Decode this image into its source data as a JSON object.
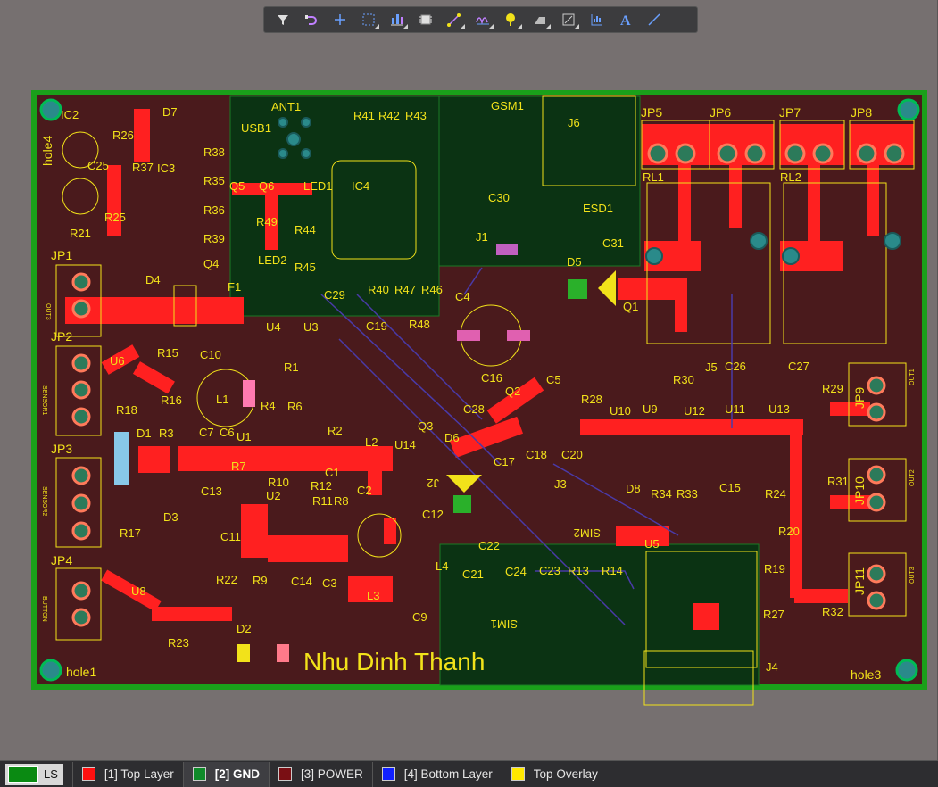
{
  "toolbar": {
    "tools": [
      {
        "name": "filter-icon"
      },
      {
        "name": "route-icon"
      },
      {
        "name": "add-icon"
      },
      {
        "name": "select-rect-icon"
      },
      {
        "name": "align-icon"
      },
      {
        "name": "component-icon"
      },
      {
        "name": "interactive-route-icon"
      },
      {
        "name": "diff-pair-icon"
      },
      {
        "name": "place-pad-icon"
      },
      {
        "name": "polygon-icon"
      },
      {
        "name": "dimension-icon"
      },
      {
        "name": "chart-icon"
      },
      {
        "name": "text-icon"
      },
      {
        "name": "line-icon"
      }
    ]
  },
  "board": {
    "designer_text": "Nhu Dinh Thanh",
    "hole_labels": [
      "hole1",
      "hole3",
      "hole4"
    ],
    "connector_labels": [
      "JP1",
      "JP2",
      "JP3",
      "JP4",
      "JP5",
      "JP6",
      "JP7",
      "JP8",
      "JP9",
      "JP10",
      "JP11"
    ],
    "component_labels": [
      "IC2",
      "IC3",
      "IC4",
      "D7",
      "R26",
      "C25",
      "R37",
      "R38",
      "R35",
      "R36",
      "R39",
      "Q4",
      "Q5",
      "Q6",
      "LED1",
      "LED2",
      "R49",
      "R44",
      "R45",
      "ANT1",
      "USB1",
      "R41",
      "R42",
      "R43",
      "GSM1",
      "J6",
      "C30",
      "J1",
      "ESD1",
      "C31",
      "RL1",
      "RL2",
      "D4",
      "D5",
      "F1",
      "C29",
      "R40",
      "R47",
      "R46",
      "C19",
      "R48",
      "C4",
      "Q1",
      "U4",
      "U3",
      "R15",
      "C10",
      "U6",
      "R1",
      "L1",
      "R16",
      "R18",
      "D1",
      "R3",
      "C7",
      "C6",
      "U1",
      "R2",
      "R4",
      "R6",
      "C1",
      "L2",
      "U14",
      "D6",
      "Q3",
      "C28",
      "C16",
      "Q2",
      "C5",
      "R28",
      "U10",
      "U9",
      "U12",
      "U11",
      "U13",
      "R30",
      "J5",
      "C26",
      "C27",
      "R29",
      "R31",
      "R24",
      "R20",
      "R19",
      "R27",
      "R32",
      "J4",
      "U2",
      "R12",
      "C13",
      "R11",
      "R8",
      "C2",
      "R7",
      "D3",
      "R17",
      "C11",
      "U8",
      "R22",
      "R9",
      "C14",
      "C3",
      "L3",
      "C12",
      "C17",
      "C18",
      "J3",
      "C20",
      "D8",
      "R34",
      "R33",
      "C15",
      "U5",
      "R13",
      "R14",
      "C22",
      "C21",
      "C24",
      "C23",
      "L4",
      "C9",
      "R23",
      "D2",
      "J2",
      "R10",
      "R25",
      "R21",
      "SIM1",
      "SIM2"
    ],
    "side_labels": [
      "OUT3",
      "SENSOR1",
      "SENSOR2",
      "BUTTON",
      "OUT1",
      "OUT2",
      "OUT3"
    ],
    "colors": {
      "board": "#4a1a1c",
      "top": "#ff2a2a",
      "gnd": "#0a3a10",
      "outline": "#1aa01a",
      "overlay": "#f2e21a"
    }
  },
  "layerbar": {
    "ls_label": "LS",
    "tabs": [
      {
        "label": "[1] Top Layer",
        "color": "#ff1010",
        "active": false
      },
      {
        "label": "[2] GND",
        "color": "#0f8a2a",
        "active": true
      },
      {
        "label": "[3] POWER",
        "color": "#7a0f14",
        "active": false
      },
      {
        "label": "[4] Bottom Layer",
        "color": "#1020ff",
        "active": false
      },
      {
        "label": "Top Overlay",
        "color": "#ffe800",
        "active": false
      }
    ]
  }
}
